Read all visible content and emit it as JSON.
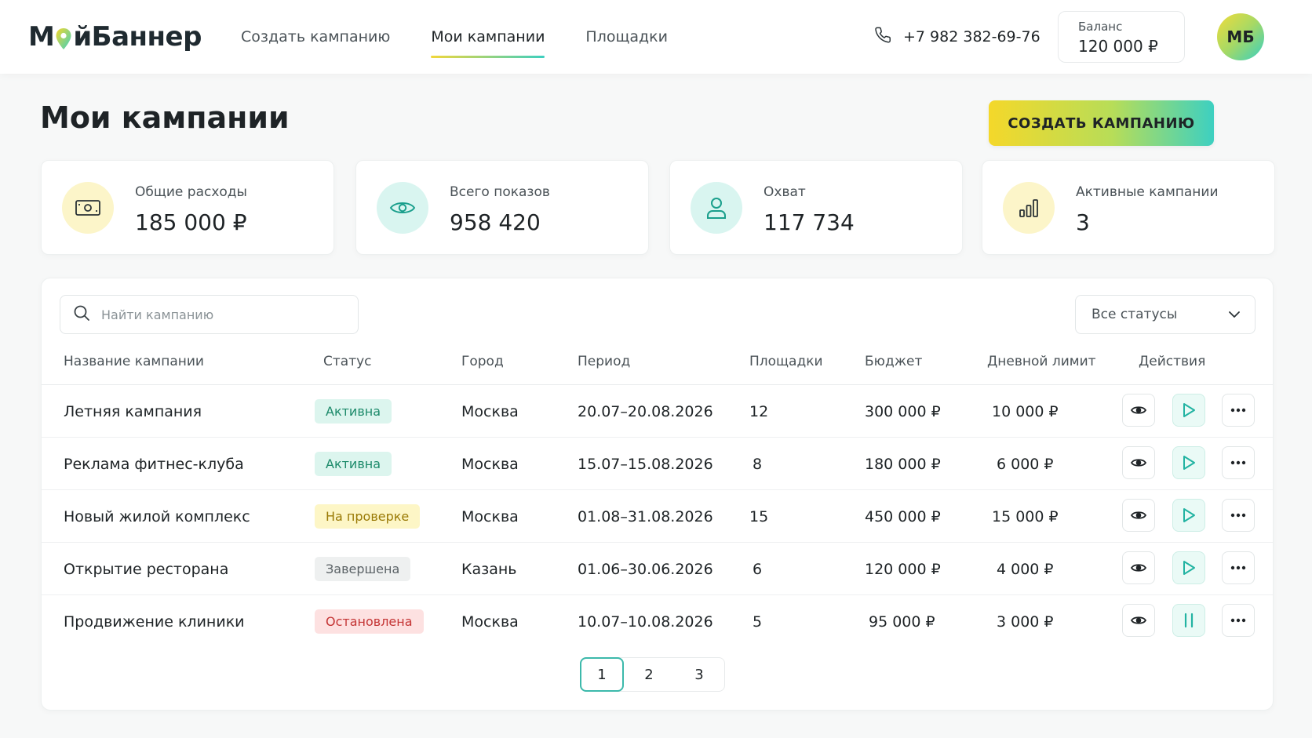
{
  "brand": {
    "name_prefix": "М",
    "name_suffix": "йБаннер",
    "accent_start": "#f4d82a",
    "accent_end": "#3dd0c1"
  },
  "nav": {
    "items": [
      {
        "label": "Создать кампанию",
        "active": false
      },
      {
        "label": "Мои кампании",
        "active": true
      },
      {
        "label": "Площадки",
        "active": false
      }
    ]
  },
  "header": {
    "phone": "+7 982 382-69-76",
    "phone_icon": "phone-icon",
    "balance_label": "Баланс",
    "balance_value": "120 000 ₽",
    "avatar_initials": "МБ"
  },
  "page": {
    "title": "Мои кампании",
    "create_button": "СОЗДАТЬ КАМПАНИЮ"
  },
  "stats": [
    {
      "label": "Общие расходы",
      "value": "185 000 ₽",
      "icon": "money-icon"
    },
    {
      "label": "Всего показов",
      "value": "958 420",
      "icon": "eye-icon"
    },
    {
      "label": "Охват",
      "value": "117 734",
      "icon": "user-icon"
    },
    {
      "label": "Активные кампании",
      "value": "3",
      "icon": "bar-chart-icon"
    }
  ],
  "filters": {
    "search_placeholder": "Найти кампанию",
    "status_select": "Все статусы"
  },
  "table": {
    "headers": {
      "name": "Название кампании",
      "status": "Статус",
      "city": "Город",
      "period": "Период",
      "sites": "Площадки",
      "budget": "Бюджет",
      "daily": "Дневной лимит",
      "actions": "Действия"
    },
    "rows": [
      {
        "name": "Летняя кампания",
        "status": "Активна",
        "status_kind": "active",
        "city": "Москва",
        "period": "20.07–20.08.2026",
        "sites": "12",
        "budget": "300 000 ₽",
        "daily": "10 000 ₽",
        "toggle": "play"
      },
      {
        "name": "Реклама фитнес-клуба",
        "status": "Активна",
        "status_kind": "active",
        "city": "Москва",
        "period": "15.07–15.08.2026",
        "sites": "8",
        "budget": "180 000 ₽",
        "daily": "6 000 ₽",
        "toggle": "play"
      },
      {
        "name": "Новый жилой комплекс",
        "status": "На проверке",
        "status_kind": "review",
        "city": "Москва",
        "period": "01.08–31.08.2026",
        "sites": "15",
        "budget": "450 000 ₽",
        "daily": "15 000 ₽",
        "toggle": "play"
      },
      {
        "name": "Открытие ресторана",
        "status": "Завершена",
        "status_kind": "done",
        "city": "Казань",
        "period": "01.06–30.06.2026",
        "sites": "6",
        "budget": "120 000 ₽",
        "daily": "4 000 ₽",
        "toggle": "play"
      },
      {
        "name": "Продвижение клиники",
        "status": "Остановлена",
        "status_kind": "stopped",
        "city": "Москва",
        "period": "10.07–10.08.2026",
        "sites": "5",
        "budget": "95 000 ₽",
        "daily": "3 000 ₽",
        "toggle": "pause"
      }
    ]
  },
  "pagination": {
    "pages": [
      "1",
      "2",
      "3"
    ],
    "current": "1"
  }
}
